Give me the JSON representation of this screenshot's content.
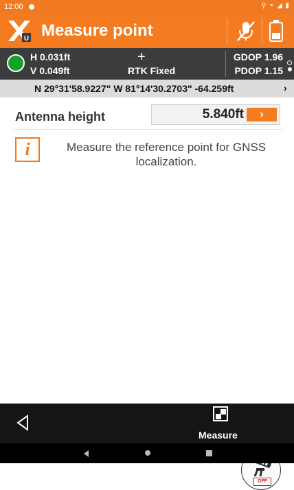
{
  "status_bar": {
    "time": "12:00",
    "right_icons": "location wifi signal battery"
  },
  "app_bar": {
    "title": "Measure point",
    "icons": [
      "app-logo-icon",
      "mic-off-icon",
      "battery-icon"
    ]
  },
  "gnss": {
    "h_precision": "H 0.031ft",
    "v_precision": "V 0.049ft",
    "fix_status": "RTK Fixed",
    "gdop": "GDOP 1.96",
    "pdop": "PDOP 1.15",
    "status_color": "#12a32a"
  },
  "coordinates": {
    "text": "N 29°31'58.9227\" W 81°14'30.2703\" -64.259ft"
  },
  "antenna": {
    "label": "Antenna height",
    "value": "5.840ft"
  },
  "info": {
    "message": "Measure the reference point for GNSS localization."
  },
  "fab": {
    "off_label": "OFF"
  },
  "bottom_bar": {
    "measure_label": "Measure"
  },
  "colors": {
    "accent": "#f47b20",
    "dark": "#3c3c3c"
  }
}
